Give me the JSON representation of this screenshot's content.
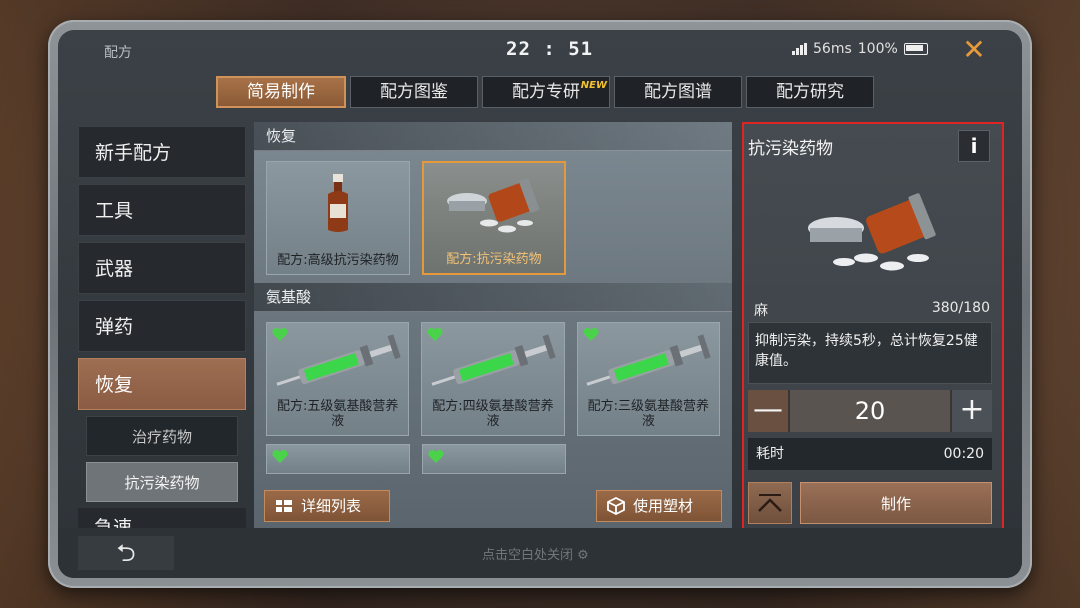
{
  "window": {
    "title": "配方",
    "clock": "22 : 51",
    "ping": "56ms",
    "battery": "100%"
  },
  "tabs": [
    {
      "label": "简易制作",
      "active": true
    },
    {
      "label": "配方图鉴",
      "active": false
    },
    {
      "label": "配方专研",
      "badge": "NEW",
      "active": false
    },
    {
      "label": "配方图谱",
      "active": false
    },
    {
      "label": "配方研究",
      "active": false
    }
  ],
  "sidebar": {
    "items": [
      {
        "label": "新手配方"
      },
      {
        "label": "工具"
      },
      {
        "label": "武器"
      },
      {
        "label": "弹药"
      },
      {
        "label": "恢复",
        "active": true
      }
    ],
    "subitems": [
      {
        "label": "治疗药物"
      },
      {
        "label": "抗污染药物",
        "active": true
      }
    ],
    "partial_item": "急速"
  },
  "sections": [
    {
      "header": "恢复",
      "cards": [
        {
          "label": "配方:高级抗污染药物",
          "art": "bottle-icon"
        },
        {
          "label": "配方:抗污染药物",
          "art": "pill-bottle-icon",
          "selected": true
        }
      ]
    },
    {
      "header": "氨基酸",
      "cards": [
        {
          "label": "配方:五级氨基酸营养液",
          "art": "syringe-icon"
        },
        {
          "label": "配方:四级氨基酸营养液",
          "art": "syringe-icon"
        },
        {
          "label": "配方:三级氨基酸营养液",
          "art": "syringe-icon"
        }
      ]
    }
  ],
  "bottom_buttons": {
    "detail_list": "详细列表",
    "use_plastic": "使用塑材"
  },
  "detail": {
    "title": "抗污染药物",
    "info_label": "i",
    "material_name": "麻",
    "material_count": "380/180",
    "description": "抑制污染，持续5秒，总计恢复25健康值。",
    "quantity": "20",
    "minus": "—",
    "plus": "+",
    "time_label": "耗时",
    "time_value": "00:20",
    "make_button": "制作"
  },
  "footer": {
    "back": "⮌",
    "close_hint": "点击空白处关闭"
  },
  "colors": {
    "accent": "#e49a3a",
    "highlight_border": "#e02424",
    "heart": "#4bd24b"
  }
}
